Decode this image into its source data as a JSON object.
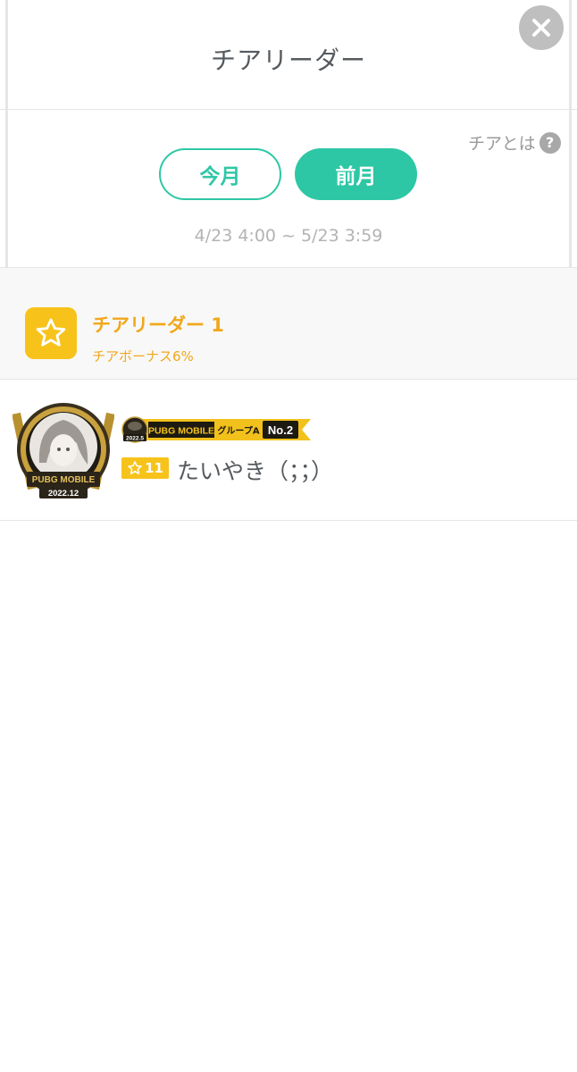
{
  "header": {
    "title": "チアリーダー",
    "close_icon": "close-icon"
  },
  "info": {
    "label": "チアとは",
    "icon_text": "?"
  },
  "tabs": [
    {
      "label": "今月",
      "selected": false
    },
    {
      "label": "前月",
      "selected": true
    }
  ],
  "period": "4/23 4:00 ~ 5/23 3:59",
  "rank_section": {
    "icon": "star-icon",
    "title": "チアリーダー 1",
    "bonus": "チアボーナス6%"
  },
  "user": {
    "name": "たいやき（；；）",
    "level": "11",
    "avatar_caption_1": "PUBG MOBILE",
    "avatar_caption_2": "2022.12",
    "banner_year": "2022.5",
    "banner_game": "PUBG MOBILE",
    "banner_group": "グループA",
    "banner_rank": "No.2"
  },
  "colors": {
    "accent": "#2ec7a5",
    "gold": "#f7c31b",
    "rank_text": "#f1a71a"
  }
}
